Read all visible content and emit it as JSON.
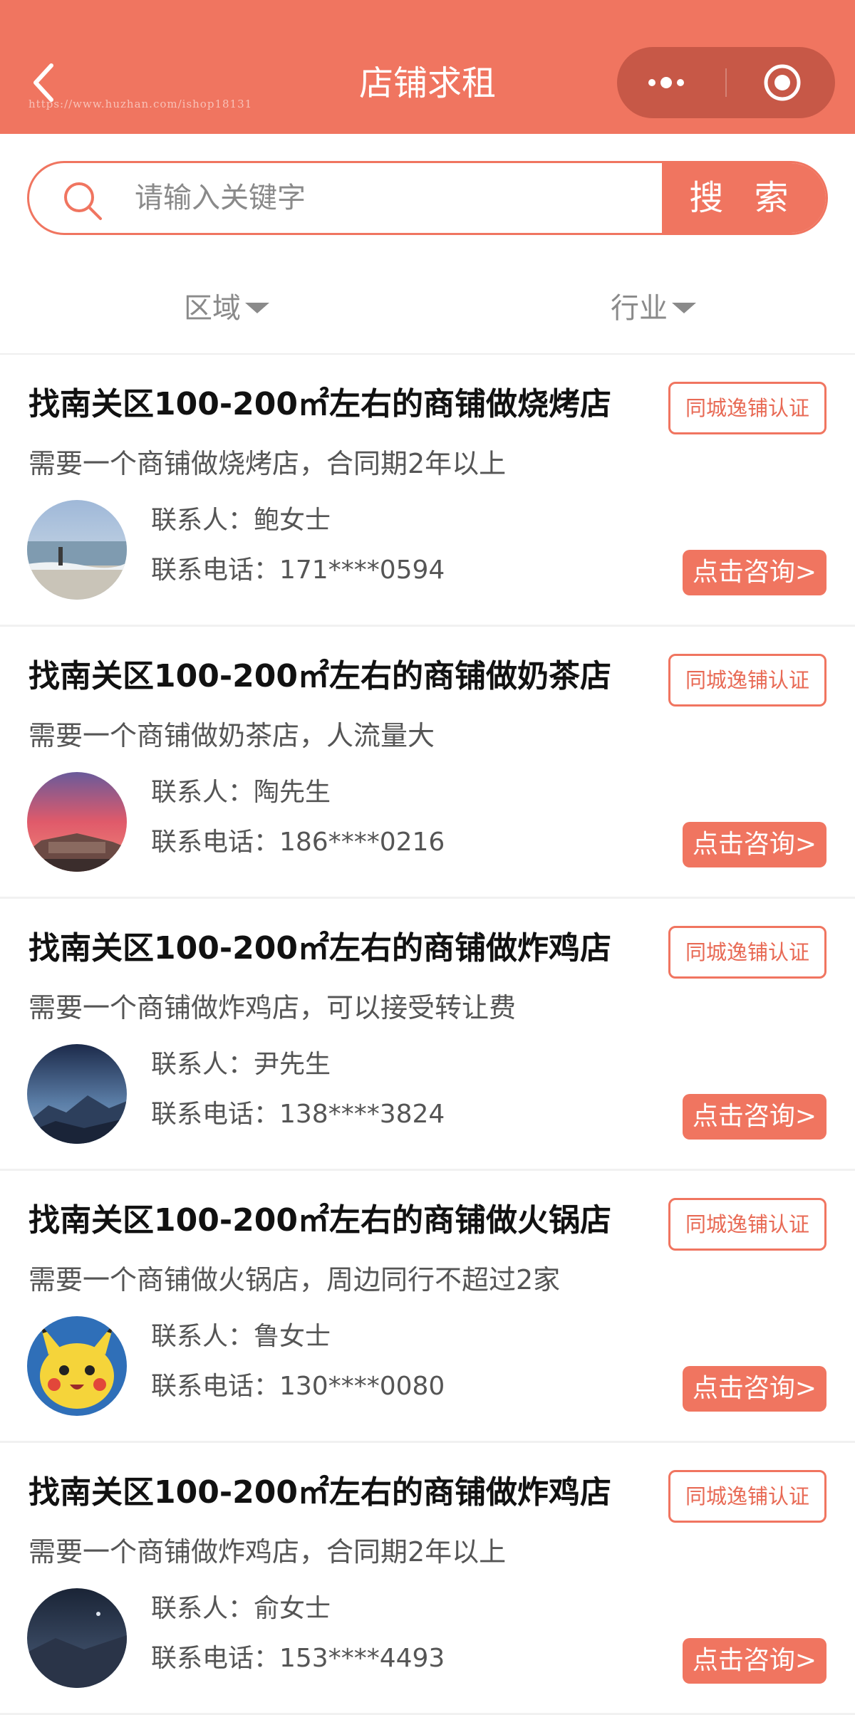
{
  "header": {
    "title": "店铺求租",
    "watermark": "https://www.huzhan.com/ishop18131"
  },
  "search": {
    "placeholder": "请输入关键字",
    "value": "",
    "button_label": "搜 索"
  },
  "filters": [
    {
      "label": "区域"
    },
    {
      "label": "行业"
    }
  ],
  "listings": [
    {
      "title": "找南关区100-200㎡左右的商铺做烧烤店",
      "badge": "同城逸铺认证",
      "description": "需要一个商铺做烧烤店，合同期2年以上",
      "contact": "联系人：鲍女士",
      "phone": "联系电话：171****0594",
      "button": "点击咨询>"
    },
    {
      "title": "找南关区100-200㎡左右的商铺做奶茶店",
      "badge": "同城逸铺认证",
      "description": "需要一个商铺做奶茶店，人流量大",
      "contact": "联系人：陶先生",
      "phone": "联系电话：186****0216",
      "button": "点击咨询>"
    },
    {
      "title": "找南关区100-200㎡左右的商铺做炸鸡店",
      "badge": "同城逸铺认证",
      "description": "需要一个商铺做炸鸡店，可以接受转让费",
      "contact": "联系人：尹先生",
      "phone": "联系电话：138****3824",
      "button": "点击咨询>"
    },
    {
      "title": "找南关区100-200㎡左右的商铺做火锅店",
      "badge": "同城逸铺认证",
      "description": "需要一个商铺做火锅店，周边同行不超过2家",
      "contact": "联系人：鲁女士",
      "phone": "联系电话：130****0080",
      "button": "点击咨询>"
    },
    {
      "title": "找南关区100-200㎡左右的商铺做炸鸡店",
      "badge": "同城逸铺认证",
      "description": "需要一个商铺做炸鸡店，合同期2年以上",
      "contact": "联系人：俞女士",
      "phone": "联系电话：153****4493",
      "button": "点击咨询>"
    }
  ],
  "colors": {
    "brand": "#F07560",
    "capsule": "#C75847",
    "title_text": "#111111",
    "secondary_text": "#555555",
    "muted_text": "#8a8a8a"
  },
  "icons": {
    "back": "back-arrow-icon",
    "more": "more-dots-icon",
    "close": "target-circle-icon",
    "search": "search-icon",
    "dropdown": "caret-down-icon"
  }
}
